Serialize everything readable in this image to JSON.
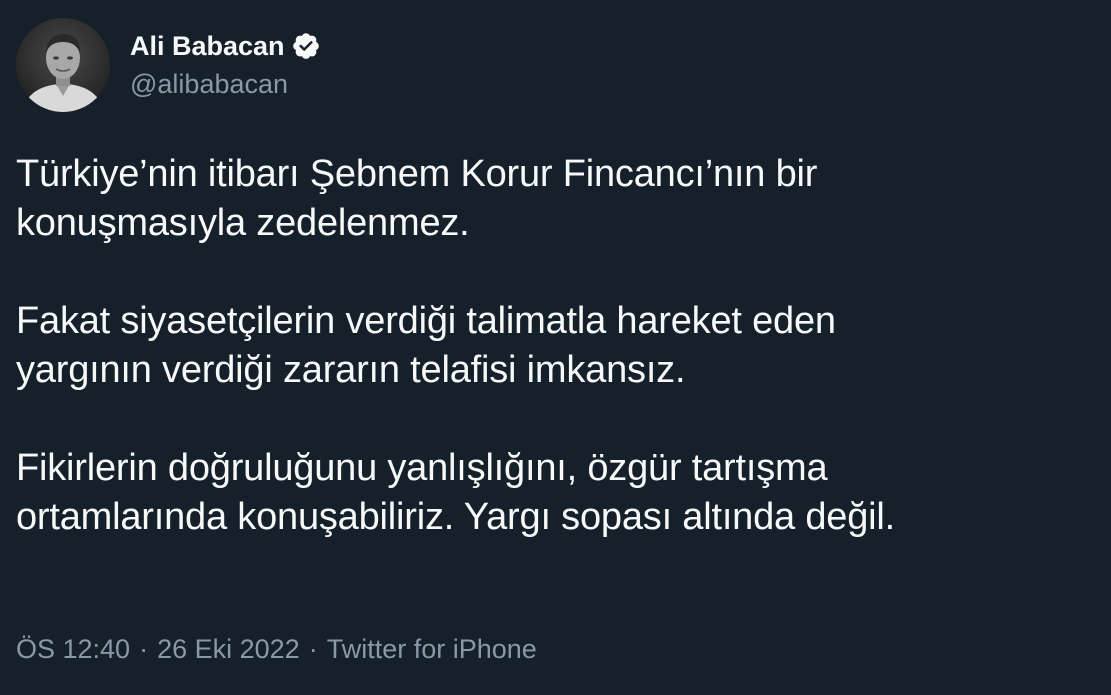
{
  "author": {
    "display_name": "Ali Babacan",
    "handle": "@alibabacan",
    "verified_icon": "verified-badge-icon",
    "accent_color": "#1d9bf0"
  },
  "tweet": {
    "lines": [
      [
        "Türkiye’nin itibarı Şebnem Korur Fincancı’nın bir",
        "konuşmasıyla zedelenmez."
      ],
      [
        "Fakat siyasetçilerin verdiği talimatla hareket eden",
        "yargının verdiği zararın telafisi imkansız."
      ],
      [
        "Fikirlerin doğruluğunu yanlışlığını, özgür tartışma",
        "ortamlarında konuşabiliriz. Yargı sopası altında değil."
      ]
    ]
  },
  "meta": {
    "time": "ÖS 12:40",
    "separator": "·",
    "date": "26 Eki 2022",
    "source": "Twitter for iPhone"
  },
  "colors": {
    "background": "#15202b",
    "text_primary": "#f7f9f9",
    "text_secondary": "#8b98a5"
  }
}
